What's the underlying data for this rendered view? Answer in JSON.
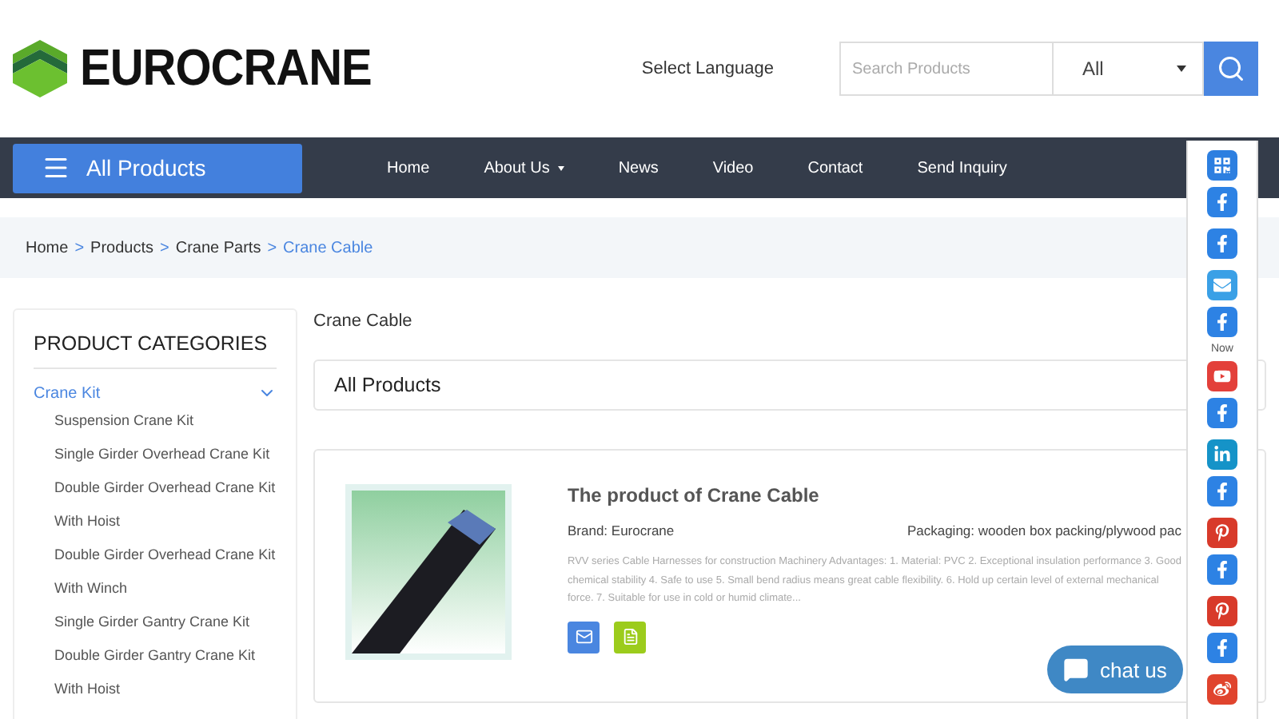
{
  "header": {
    "logo_text": "EUROCRANE",
    "language_label": "Select Language",
    "search": {
      "placeholder": "Search Products"
    },
    "search_scope": "All"
  },
  "nav": {
    "all_products": "All Products",
    "items": [
      {
        "label": "Home",
        "has_menu": false
      },
      {
        "label": "About Us",
        "has_menu": true
      },
      {
        "label": "News",
        "has_menu": false
      },
      {
        "label": "Video",
        "has_menu": false
      },
      {
        "label": "Contact",
        "has_menu": false
      },
      {
        "label": "Send Inquiry",
        "has_menu": false
      }
    ]
  },
  "breadcrumb": {
    "separator": ">",
    "items": [
      {
        "label": "Home",
        "current": false
      },
      {
        "label": "Products",
        "current": false
      },
      {
        "label": "Crane Parts",
        "current": false
      },
      {
        "label": "Crane Cable",
        "current": true
      }
    ]
  },
  "sidebar": {
    "title": "PRODUCT CATEGORIES",
    "categories": [
      {
        "label": "Crane Kit",
        "selected": true,
        "expanded": true,
        "children": [
          {
            "label": "Suspension Crane Kit"
          },
          {
            "label": "Single Girder Overhead Crane Kit"
          },
          {
            "label": "Double Girder Overhead Crane Kit"
          },
          {
            "label": "With Hoist"
          },
          {
            "label": "Double Girder Overhead Crane Kit"
          },
          {
            "label": "With Winch"
          },
          {
            "label": "Single Girder Gantry Crane Kit"
          },
          {
            "label": "Double Girder Gantry Crane Kit"
          },
          {
            "label": "With Hoist"
          }
        ]
      }
    ]
  },
  "main": {
    "heading": "Crane Cable",
    "filter_label": "All Products",
    "products": [
      {
        "title": "The product of Crane Cable",
        "brand": "Brand: Eurocrane",
        "packaging": "Packaging: wooden box packing/plywood pac",
        "description": "RVV series Cable Harnesses for construction Machinery Advantages: 1. Material: PVC 2. Exceptional insulation performance 3. Good chemical stability 4. Safe to use 5. Small bend radius means great cable flexibility. 6. Hold up certain level of external mechanical force. 7. Suitable for use in cold or humid climate..."
      }
    ]
  },
  "social_bar": [
    {
      "kind": "qr"
    },
    {
      "kind": "facebook"
    },
    {
      "kind": "facebook"
    },
    {
      "kind": "mail"
    },
    {
      "kind": "facebook"
    },
    {
      "kind": "label",
      "text": "Now"
    },
    {
      "kind": "youtube"
    },
    {
      "kind": "facebook"
    },
    {
      "kind": "linkedin"
    },
    {
      "kind": "facebook"
    },
    {
      "kind": "pinterest"
    },
    {
      "kind": "facebook"
    },
    {
      "kind": "pinterest"
    },
    {
      "kind": "facebook"
    },
    {
      "kind": "weibo"
    }
  ],
  "chat": {
    "label": "chat us"
  }
}
